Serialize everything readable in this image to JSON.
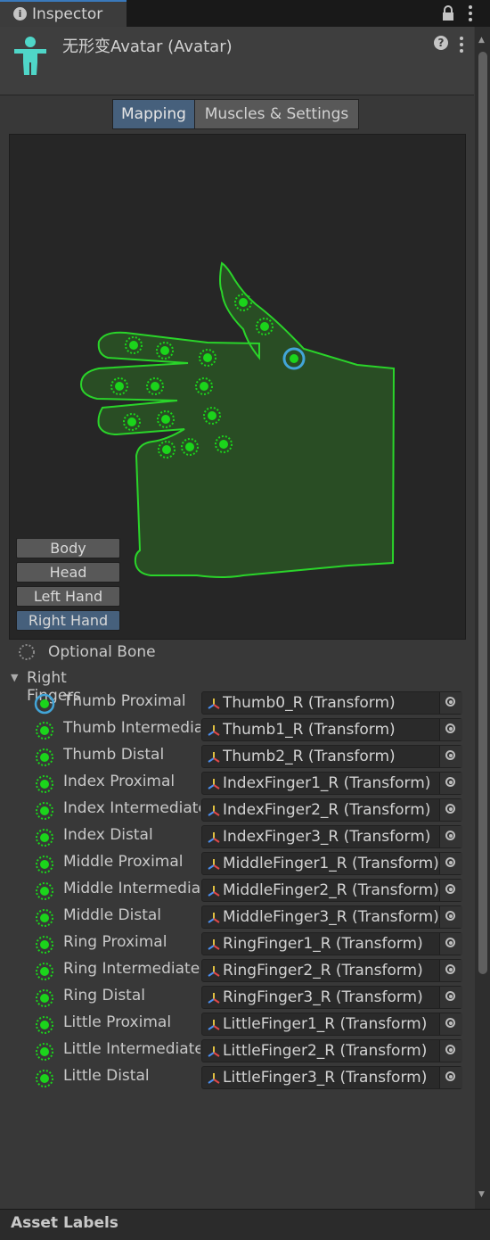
{
  "tab": {
    "title": "Inspector",
    "icon": "info-icon"
  },
  "header": {
    "title": "无形变Avatar (Avatar)",
    "icon": "humanoid-avatar-icon"
  },
  "segments": [
    {
      "label": "Mapping",
      "active": true
    },
    {
      "label": "Muscles & Settings",
      "active": false
    }
  ],
  "view_buttons": [
    {
      "label": "Body",
      "active": false
    },
    {
      "label": "Head",
      "active": false
    },
    {
      "label": "Left Hand",
      "active": false
    },
    {
      "label": "Right Hand",
      "active": true
    }
  ],
  "optional_bone": {
    "label": "Optional Bone"
  },
  "group": {
    "label": "Right Fingers",
    "expanded": true
  },
  "bones": [
    {
      "name": "Thumb Proximal",
      "value": "Thumb0_R (Transform)",
      "selected": true
    },
    {
      "name": "Thumb Intermediate",
      "value": "Thumb1_R (Transform)"
    },
    {
      "name": "Thumb Distal",
      "value": "Thumb2_R (Transform)"
    },
    {
      "name": "Index Proximal",
      "value": "IndexFinger1_R (Transform)"
    },
    {
      "name": "Index Intermediate",
      "value": "IndexFinger2_R (Transform)"
    },
    {
      "name": "Index Distal",
      "value": "IndexFinger3_R (Transform)"
    },
    {
      "name": "Middle Proximal",
      "value": "MiddleFinger1_R (Transform)"
    },
    {
      "name": "Middle Intermediate",
      "value": "MiddleFinger2_R (Transform)"
    },
    {
      "name": "Middle Distal",
      "value": "MiddleFinger3_R (Transform)"
    },
    {
      "name": "Ring Proximal",
      "value": "RingFinger1_R (Transform)"
    },
    {
      "name": "Ring Intermediate",
      "value": "RingFinger2_R (Transform)"
    },
    {
      "name": "Ring Distal",
      "value": "RingFinger3_R (Transform)"
    },
    {
      "name": "Little Proximal",
      "value": "LittleFinger1_R (Transform)"
    },
    {
      "name": "Little Intermediate",
      "value": "LittleFinger2_R (Transform)"
    },
    {
      "name": "Little Distal",
      "value": "LittleFinger3_R (Transform)"
    }
  ],
  "footer": {
    "label": "Asset Labels"
  },
  "colors": {
    "accent": "#3a79bb",
    "active_button": "#46607c",
    "bone_green": "#1bd41b",
    "hand_fill": "#294d24",
    "hand_stroke": "#2ad42a",
    "selected_ring": "#42a5d8"
  }
}
